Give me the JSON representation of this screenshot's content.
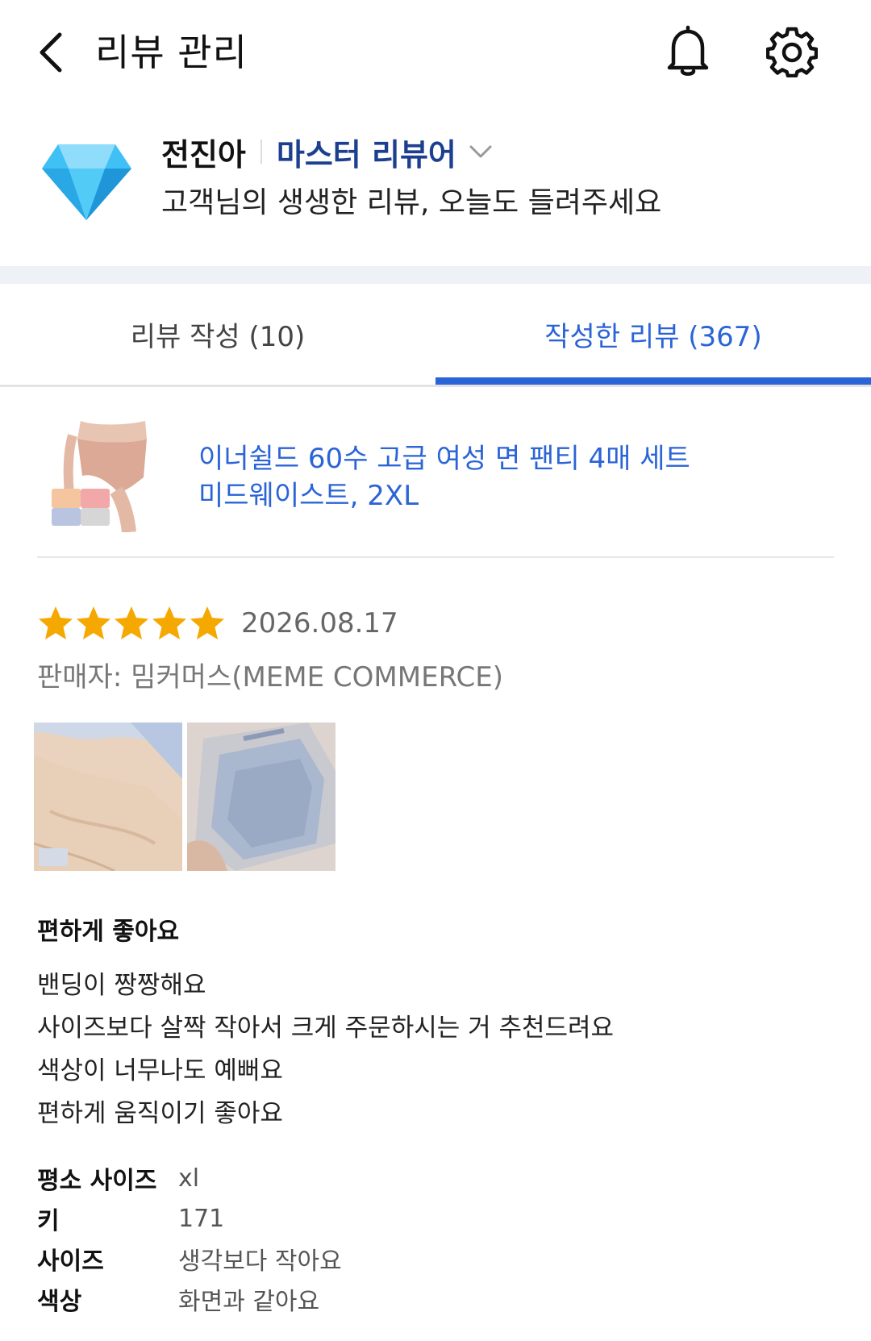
{
  "header": {
    "title": "리뷰 관리"
  },
  "profile": {
    "name": "전진아",
    "grade": "마스터 리뷰어",
    "message": "고객님의 생생한 리뷰, 오늘도 들려주세요"
  },
  "tabs": [
    {
      "label": "리뷰 작성 (10)",
      "active": false
    },
    {
      "label": "작성한 리뷰 (367)",
      "active": true
    }
  ],
  "product": {
    "name_line1": "이너쉴드 60수 고급 여성 면 팬티 4매 세트",
    "name_line2": "미드웨이스트, 2XL"
  },
  "review": {
    "rating": 5,
    "max_rating": 5,
    "date": "2026.08.17",
    "seller": "판매자: 밈커머스(MEME COMMERCE)",
    "title": "편하게 좋아요",
    "lines": [
      "밴딩이 짱짱해요",
      "사이즈보다 살짝 작아서 크게 주문하시는 거 추천드려요",
      "색상이 너무나도 예뻐요",
      "편하게 움직이기 좋아요"
    ],
    "details": [
      {
        "label": "평소 사이즈",
        "value": "xl"
      },
      {
        "label": "키",
        "value": "171"
      },
      {
        "label": "사이즈",
        "value": "생각보다 작아요"
      },
      {
        "label": "색상",
        "value": "화면과 같아요"
      }
    ]
  },
  "colors": {
    "accent": "#2b64d6",
    "grade": "#1d3f8f",
    "star": "#f5a800",
    "diamond": "#3fc1f5"
  },
  "icons": [
    "back-arrow-icon",
    "bell-icon",
    "gear-icon",
    "diamond-icon",
    "chevron-down-icon",
    "star-icon"
  ]
}
